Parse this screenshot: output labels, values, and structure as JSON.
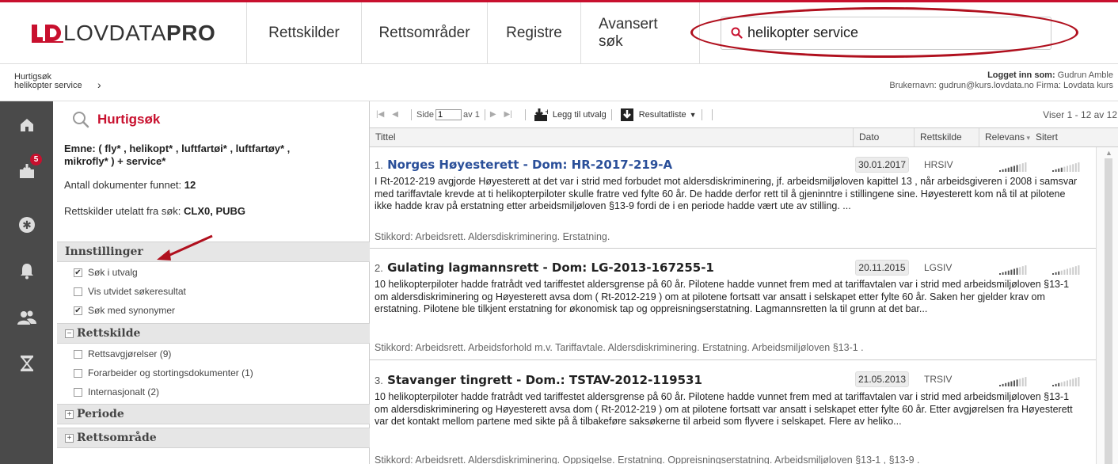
{
  "header": {
    "logo_text": "LOVDATA",
    "logo_bold": "PRO",
    "nav": [
      "Rettskilder",
      "Rettsområder",
      "Registre",
      "Avansert søk"
    ],
    "search_value": "helikopter service"
  },
  "breadcrumb": {
    "line1": "Hurtigsøk",
    "line2": "helikopter service"
  },
  "login": {
    "label": "Logget inn som:",
    "name": "Gudrun Amble",
    "line2": "Brukernavn: gudrun@kurs.lovdata.no Firma: Lovdata kurs"
  },
  "rail": {
    "badge": "5",
    "icons": [
      "home-icon",
      "inbox-icon",
      "star-badge-icon",
      "bell-icon",
      "users-icon",
      "hourglass-icon"
    ]
  },
  "left": {
    "title": "Hurtigsøk",
    "emne": "Emne: ( fly* , helikopt* , luftfartøi* , luftfartøy* , mikrofly* ) + service*",
    "antall_label": "Antall dokumenter funnet:",
    "antall_value": "12",
    "utelatt_label": "Rettskilder utelatt fra søk:",
    "utelatt_value": "CLX0, PUBG",
    "innstillinger": "Innstillinger",
    "options": [
      {
        "label": "Søk i utvalg",
        "checked": true
      },
      {
        "label": "Vis utvidet søkeresultat",
        "checked": false
      },
      {
        "label": "Søk med synonymer",
        "checked": true
      }
    ],
    "rettskilde": "Rettskilde",
    "rettskilde_options": [
      {
        "label": "Rettsavgjørelser (9)",
        "checked": false
      },
      {
        "label": "Forarbeider og stortingsdokumenter (1)",
        "checked": false
      },
      {
        "label": "Internasjonalt (2)",
        "checked": false
      }
    ],
    "periode": "Periode",
    "rettsomrade": "Rettsområde"
  },
  "toolbar": {
    "side_label": "Side",
    "page": "1",
    "av": "av 1",
    "legg_til": "Legg til utvalg",
    "resultatliste": "Resultatliste",
    "viser": "Viser 1 - 12 av 12"
  },
  "columns": {
    "tittel": "Tittel",
    "dato": "Dato",
    "rettskilde": "Rettskilde",
    "relevans": "Relevans",
    "sitert": "Sitert"
  },
  "results": [
    {
      "num": "1.",
      "title": "Norges Høyesterett - Dom: HR-2017-219-A",
      "date": "30.01.2017",
      "kilde": "HRSIV",
      "relevans": 0.7,
      "sitert": 0.4,
      "body": "I Rt-2012-219 avgjorde Høyesterett at det var i strid med forbudet mot aldersdiskriminering, jf. arbeidsmiljøloven kapittel 13 , når arbeidsgiveren i 2008 i samsvar med tariffavtale krevde at ti helikopterpiloter skulle fratre ved fylte 60 år. De hadde derfor rett til å gjeninntre i stillingene sine. Høyesterett kom nå til at pilotene ikke hadde krav på erstatning etter arbeidsmiljøloven §13-9 fordi de i en periode hadde vært ute av stilling. ...",
      "stikkord": "Stikkord: Arbeidsrett. Aldersdiskriminering. Erstatning."
    },
    {
      "num": "2.",
      "title": "Gulating lagmannsrett - Dom: LG-2013-167255-1",
      "date": "20.11.2015",
      "kilde": "LGSIV",
      "relevans": 0.7,
      "sitert": 0.3,
      "body": "10 helikopterpiloter hadde fratrådt ved tariffestet aldersgrense på 60 år. Pilotene hadde vunnet frem med at tariffavtalen var i strid med arbeidsmiljøloven §13-1 om aldersdiskriminering og Høyesterett avsa dom ( Rt-2012-219 ) om at pilotene fortsatt var ansatt i selskapet etter fylte 60 år. Saken her gjelder krav om erstatning. Pilotene ble tilkjent erstatning for økonomisk tap og oppreisningserstatning. Lagmannsretten la til grunn at det bar...",
      "stikkord": "Stikkord: Arbeidsrett. Arbeidsforhold m.v. Tariffavtale. Aldersdiskriminering. Erstatning. Arbeidsmiljøloven §13-1 ."
    },
    {
      "num": "3.",
      "title": "Stavanger tingrett - Dom.: TSTAV-2012-119531",
      "date": "21.05.2013",
      "kilde": "TRSIV",
      "relevans": 0.7,
      "sitert": 0.3,
      "body": "10 helikopterpiloter hadde fratrådt ved tariffestet aldersgrense på 60 år. Pilotene hadde vunnet frem med at tariffavtalen var i strid med arbeidsmiljøloven §13-1 om aldersdiskriminering og Høyesterett avsa dom ( Rt-2012-219 ) om at pilotene fortsatt var ansatt i selskapet etter fylte 60 år. Etter avgjørelsen fra Høyesterett var det kontakt mellom partene med sikte på å tilbakeføre saksøkerne til arbeid som flyvere i selskapet. Flere av heliko...",
      "stikkord": "Stikkord: Arbeidsrett. Aldersdiskriminering. Oppsigelse. Erstatning. Oppreisningserstatning. Arbeidsmiljøloven §13-1 , §13-9 ."
    }
  ],
  "colors": {
    "brand_red": "#c8102e",
    "link_blue": "#2a4f99",
    "rail": "#4a4a4a"
  }
}
